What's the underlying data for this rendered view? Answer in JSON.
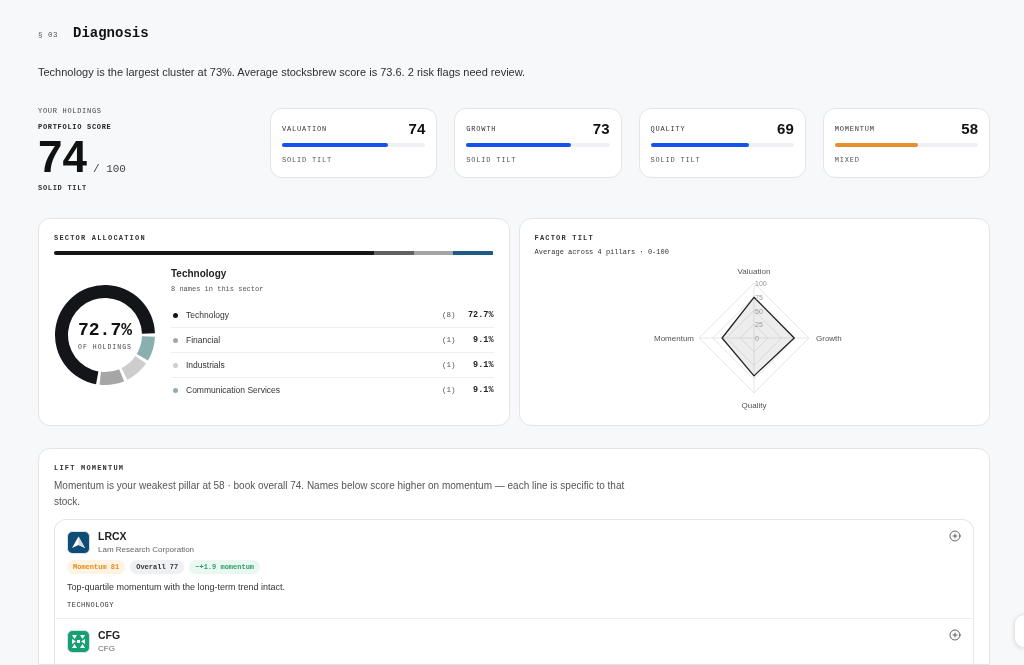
{
  "section": {
    "number": "§ 03",
    "title": "Diagnosis"
  },
  "summary": "Technology is the largest cluster at 73%. Average stocksbrew score is 73.6. 2 risk flags need review.",
  "portfolio": {
    "eyebrow": "YOUR HOLDINGS",
    "label": "PORTFOLIO SCORE",
    "score": "74",
    "out_of": "/ 100",
    "caption": "SOLID TILT"
  },
  "pillars": [
    {
      "label": "VALUATION",
      "score": "74",
      "level": 0.74,
      "caption": "SOLID TILT",
      "color": "#1652f0"
    },
    {
      "label": "GROWTH",
      "score": "73",
      "level": 0.73,
      "caption": "SOLID TILT",
      "color": "#1652f0"
    },
    {
      "label": "QUALITY",
      "score": "69",
      "level": 0.69,
      "caption": "SOLID TILT",
      "color": "#1652f0"
    },
    {
      "label": "MOMENTUM",
      "score": "58",
      "level": 0.58,
      "caption": "MIXED",
      "color": "#e8912a"
    }
  ],
  "sector_allocation": {
    "title": "SECTOR ALLOCATION",
    "allocation_bar": [
      {
        "color": "#141518"
      },
      {
        "color": "#5f6165"
      },
      {
        "color": "#a3a4a6"
      },
      {
        "color": "#1d5b84"
      }
    ],
    "focus_name": "Technology",
    "focus_note": "8 names in this sector",
    "center_value": "72.7%",
    "center_label": "OF HOLDINGS",
    "sectors": [
      {
        "name": "Technology",
        "count": "(8)",
        "share": "72.7%",
        "color": "#141518"
      },
      {
        "name": "Financial",
        "count": "(1)",
        "share": "9.1%",
        "color": "#a6a6a6"
      },
      {
        "name": "Industrials",
        "count": "(1)",
        "share": "9.1%",
        "color": "#cdcdcd"
      },
      {
        "name": "Communication Services",
        "count": "(1)",
        "share": "9.1%",
        "color": "#8aafaf"
      }
    ],
    "chart_data": {
      "type": "donut",
      "values": [
        72.7,
        9.1,
        9.1,
        9.1
      ]
    }
  },
  "factor_tilt": {
    "title": "FACTOR TILT",
    "subtitle": "Average across 4 pillars · 0-100",
    "axes": [
      "Valuation",
      "Growth",
      "Quality",
      "Momentum"
    ],
    "ticks": [
      "100",
      "75",
      "50",
      "25",
      "0"
    ]
  },
  "lift": {
    "title": "LIFT MOMENTUM",
    "text": "Momentum is your weakest pillar at 58 · book overall 74. Names below score higher on momentum — each line is specific to that stock.",
    "stocks": [
      {
        "ticker": "LRCX",
        "name": "Lam Research Corporation",
        "color": "#0f4c75",
        "tags": [
          {
            "kind": "momentum",
            "text": "Momentum 81"
          },
          {
            "kind": "overall",
            "text": "Overall 77"
          },
          {
            "kind": "delta",
            "text": "~+1.9 momentum"
          }
        ],
        "note": "Top-quartile momentum with the long-term trend intact.",
        "sector": "TECHNOLOGY"
      },
      {
        "ticker": "CFG",
        "name": "CFG",
        "color": "#17a06f"
      }
    ]
  }
}
